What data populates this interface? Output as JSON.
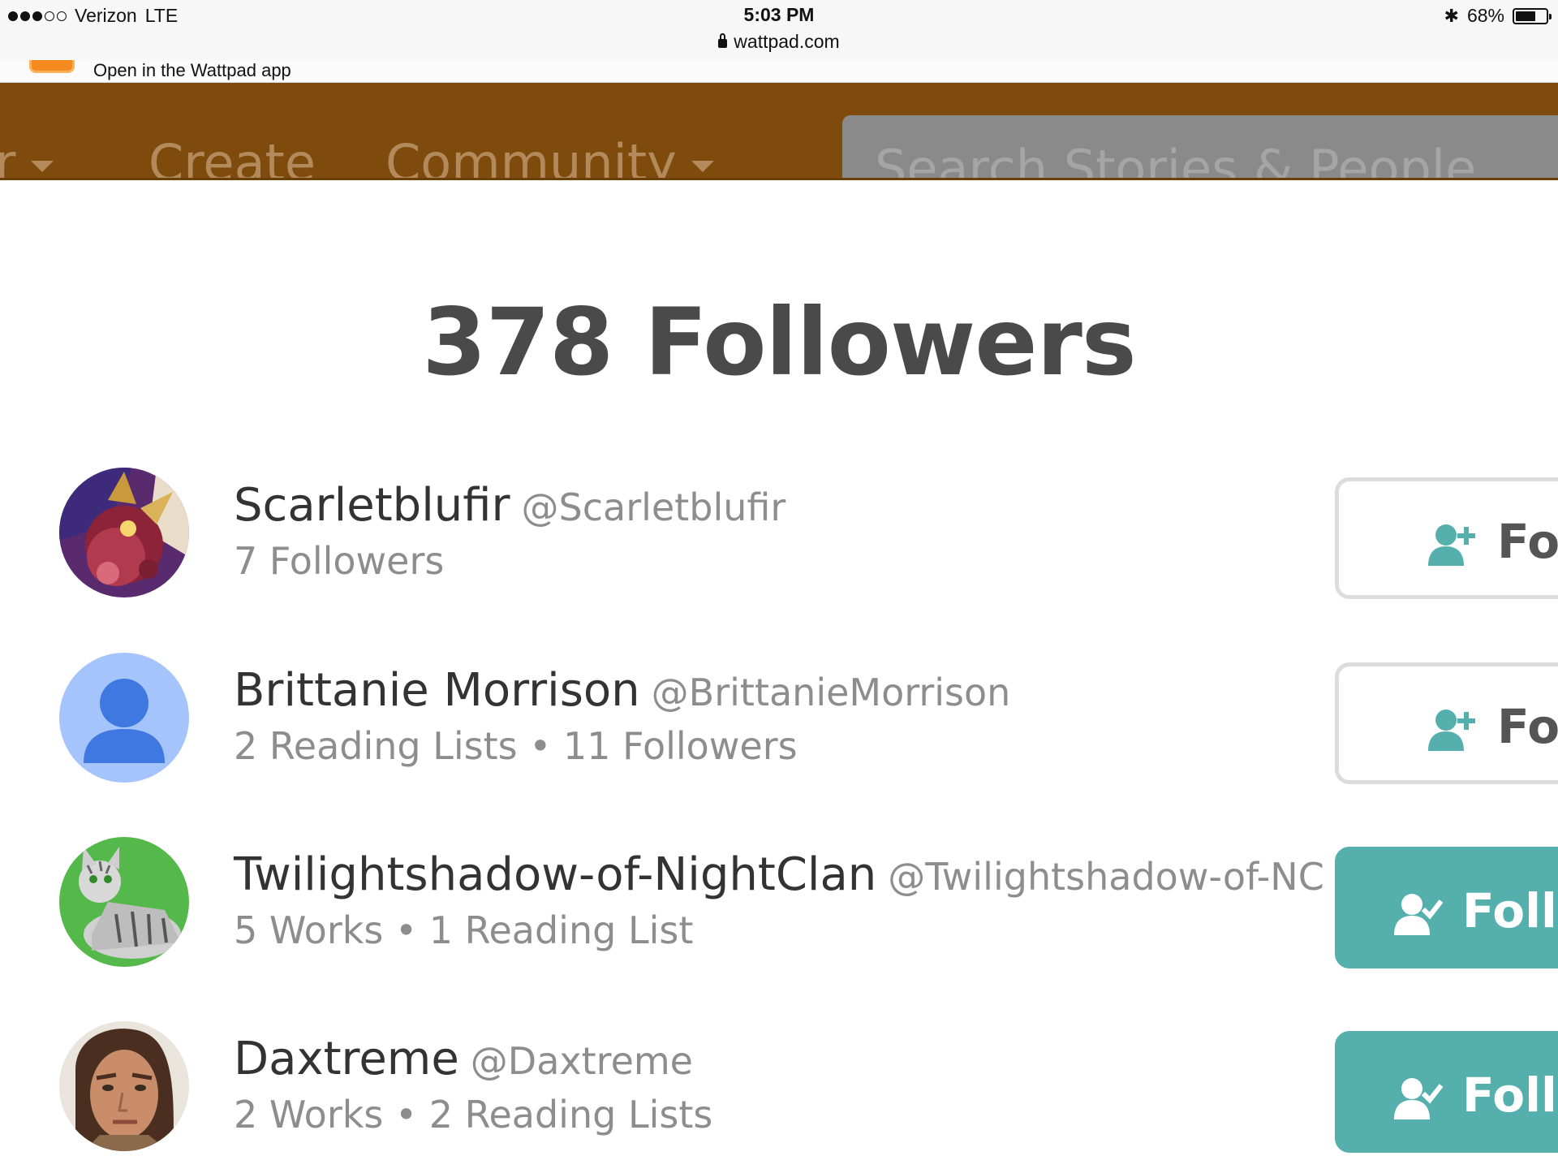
{
  "status_bar": {
    "carrier": "Verizon",
    "network": "LTE",
    "time": "5:03 PM",
    "url": "wattpad.com",
    "battery": "68%",
    "battery_level": 0.68
  },
  "app_banner": {
    "text": "Open in the Wattpad app"
  },
  "nav": {
    "partial_item": "r",
    "create": "Create",
    "community": "Community",
    "search_placeholder": "Search Stories & People"
  },
  "page": {
    "title": "378 Followers"
  },
  "followers": [
    {
      "name": "Scarletblufir",
      "handle": "@Scarletblufir",
      "stats": "7 Followers",
      "button_label": "Fol",
      "following": false
    },
    {
      "name": "Brittanie Morrison",
      "handle": "@BrittanieMorrison",
      "stats": "2 Reading Lists • 11 Followers",
      "button_label": "Fol",
      "following": false
    },
    {
      "name": "Twilightshadow-of-NightClan",
      "handle": "@Twilightshadow-of-NC",
      "stats": "5 Works • 1 Reading List",
      "button_label": "Follo",
      "following": true
    },
    {
      "name": "Daxtreme",
      "handle": "@Daxtreme",
      "stats": "2 Works • 2 Reading Lists",
      "button_label": "Follo",
      "following": true
    }
  ],
  "colors": {
    "nav_bg": "#7f4b0c",
    "follow_teal": "#55b0ad",
    "title_text": "#4a4a4a",
    "muted_text": "#8d8d8d"
  }
}
